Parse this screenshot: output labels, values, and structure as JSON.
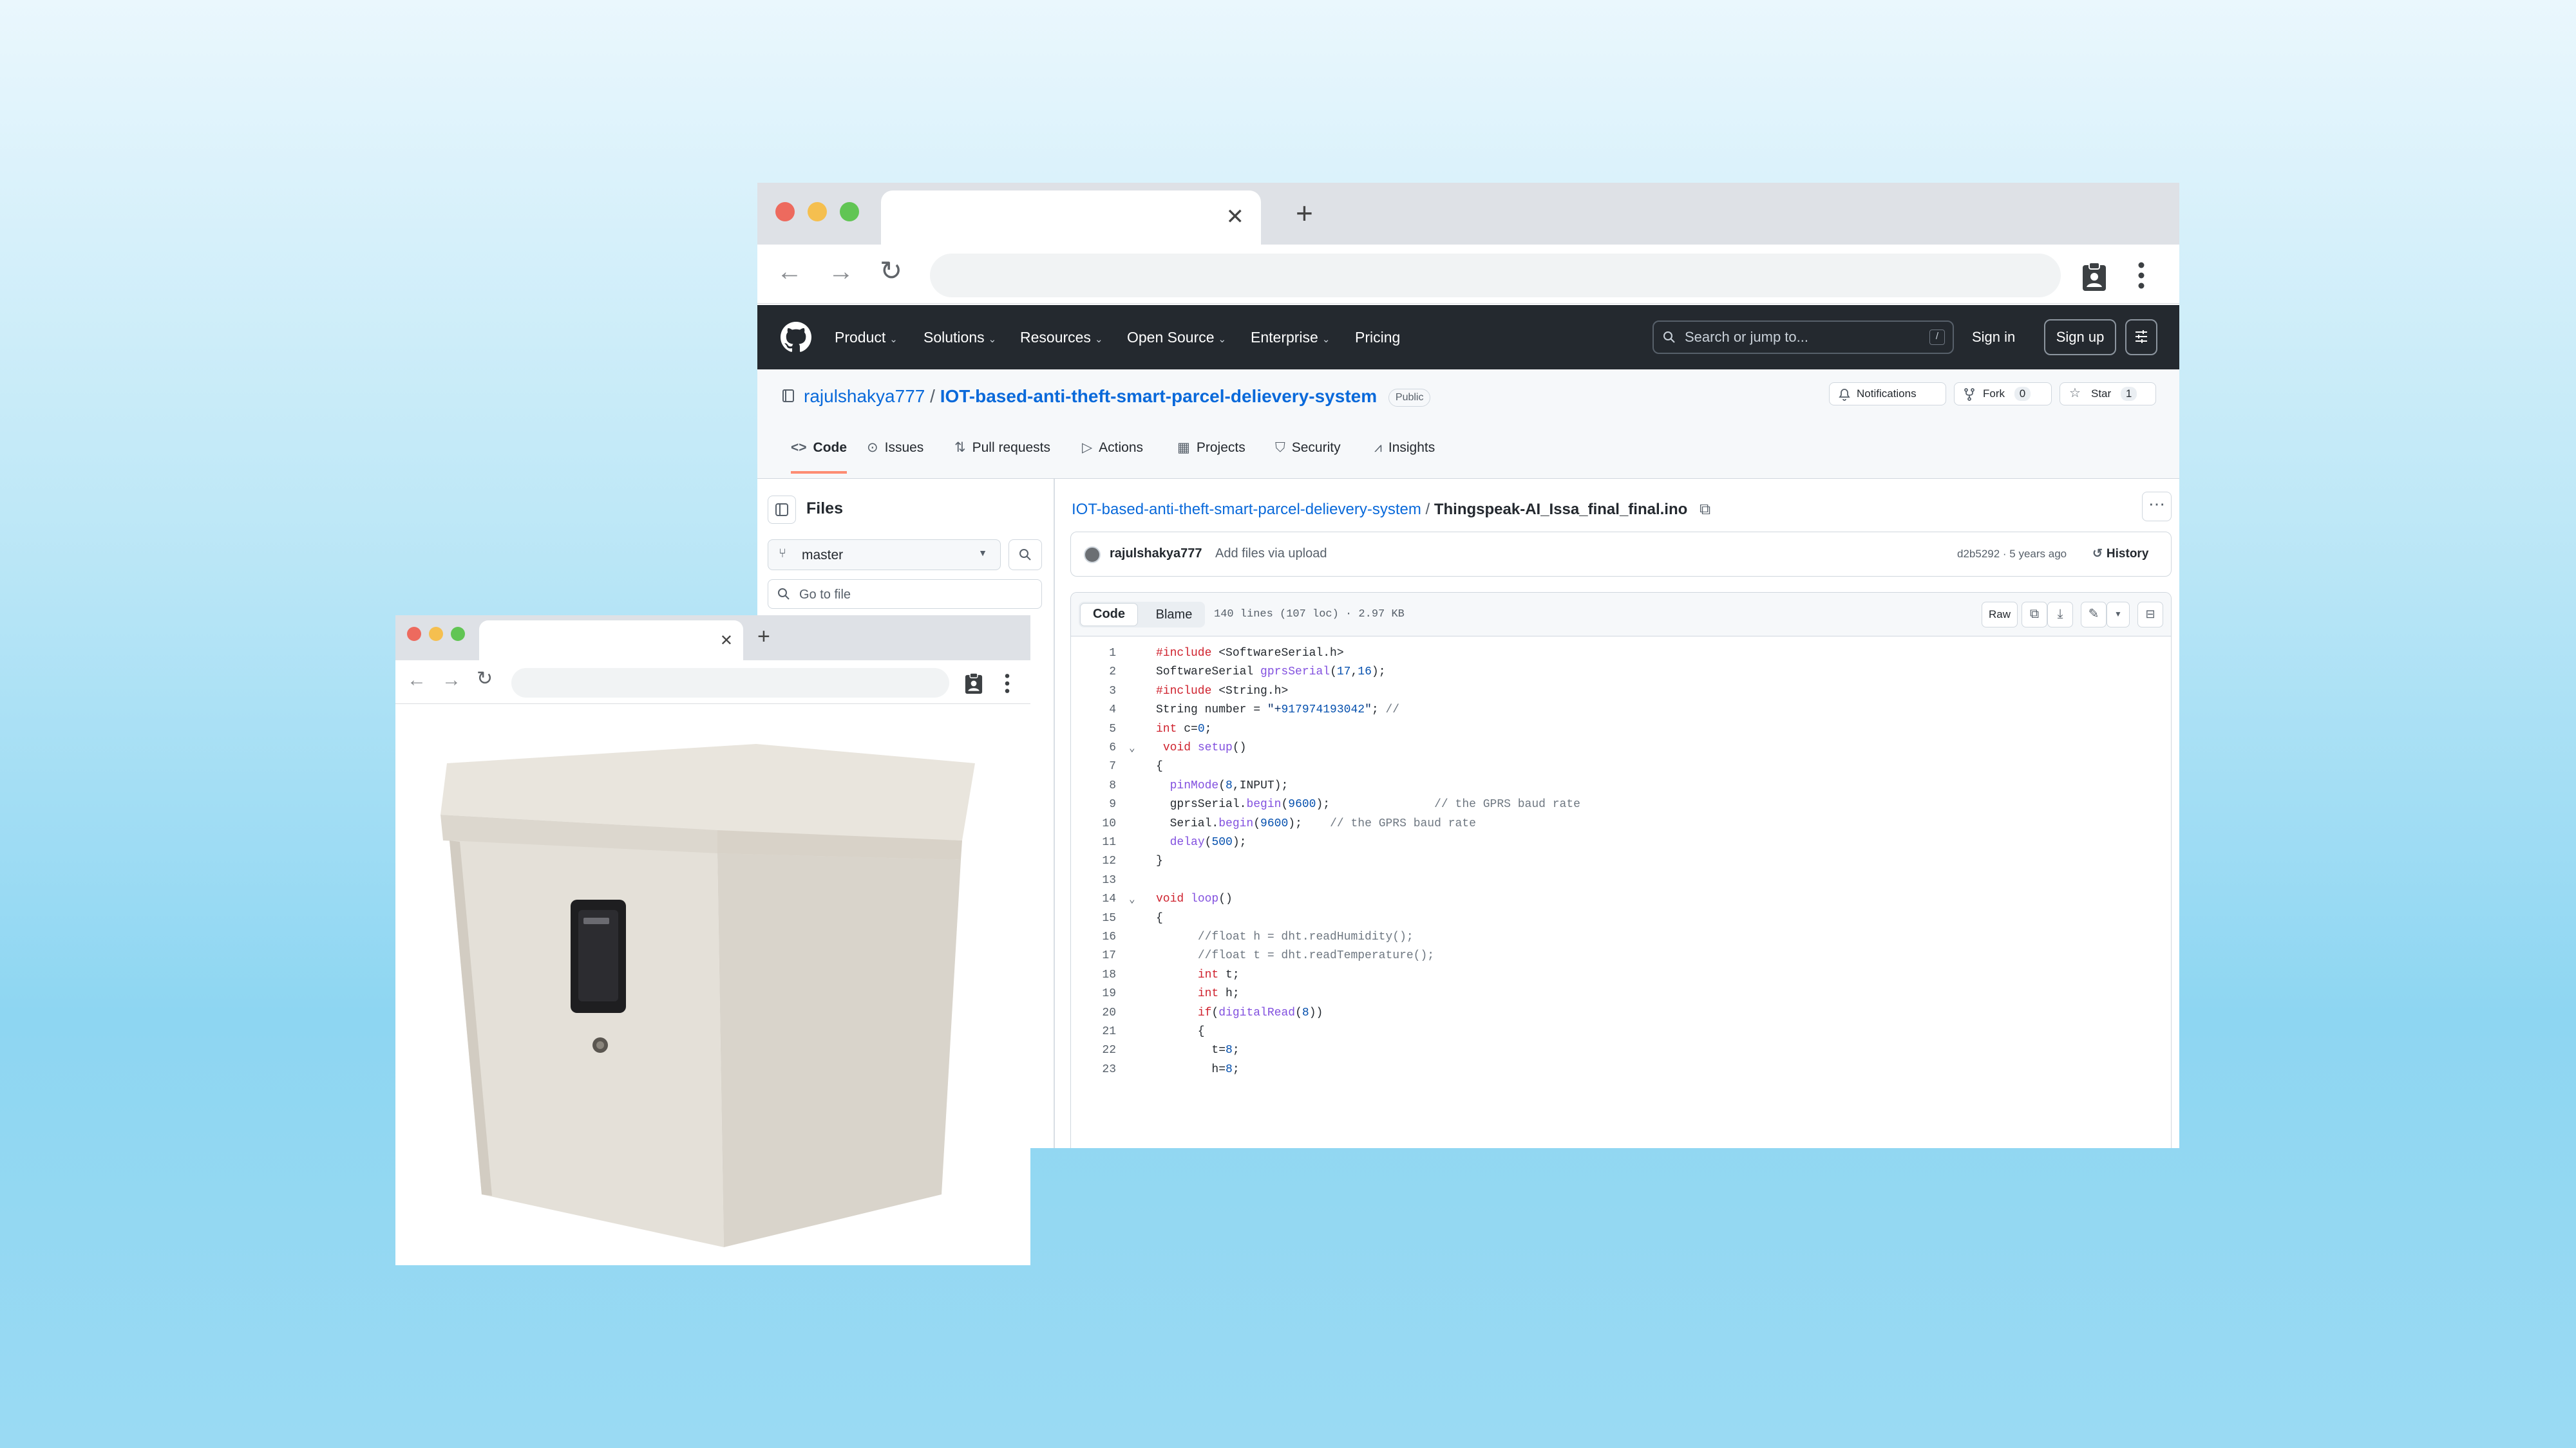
{
  "github": {
    "nav": [
      "Product",
      "Solutions",
      "Resources",
      "Open Source",
      "Enterprise",
      "Pricing"
    ],
    "search_placeholder": "Search or jump to...",
    "search_shortcut": "/",
    "sign_in": "Sign in",
    "sign_up": "Sign up"
  },
  "repo": {
    "owner": "rajulshakya777",
    "name": "IOT-based-anti-theft-smart-parcel-delievery-system",
    "visibility": "Public",
    "notifications": "Notifications",
    "fork_label": "Fork",
    "fork_count": "0",
    "star_label": "Star",
    "star_count": "1",
    "tabs": [
      "Code",
      "Issues",
      "Pull requests",
      "Actions",
      "Projects",
      "Security",
      "Insights"
    ]
  },
  "files": {
    "title": "Files",
    "branch": "master",
    "goto": "Go to file"
  },
  "file": {
    "repo_link": "IOT-based-anti-theft-smart-parcel-delievery-system",
    "separator": "/",
    "name": "Thingspeak-AI_Issa_final_final.ino",
    "author": "rajulshakya777",
    "message": "Add files via upload",
    "commit_meta": "d2b5292 · 5 years ago",
    "history": "History",
    "view_code": "Code",
    "view_blame": "Blame",
    "stats": "140 lines (107 loc) · 2.97 KB",
    "raw": "Raw",
    "lines": [
      "#include <SoftwareSerial.h>",
      "SoftwareSerial gprsSerial(17,16);",
      "#include <String.h>",
      "String number = \"+917974193042\"; //",
      "int c=0;",
      " void setup()",
      "{",
      "  pinMode(8,INPUT);",
      "  gprsSerial.begin(9600);               // the GPRS baud rate",
      "  Serial.begin(9600);    // the GPRS baud rate",
      "  delay(500);",
      "}",
      "",
      "void loop()",
      "{",
      "      //float h = dht.readHumidity();",
      "      //float t = dht.readTemperature();",
      "      int t;",
      "      int h;",
      "      if(digitalRead(8))",
      "      {",
      "        t=8;",
      "        h=8;"
    ]
  },
  "product_window": {
    "image_label": "parcel-box-photo"
  }
}
